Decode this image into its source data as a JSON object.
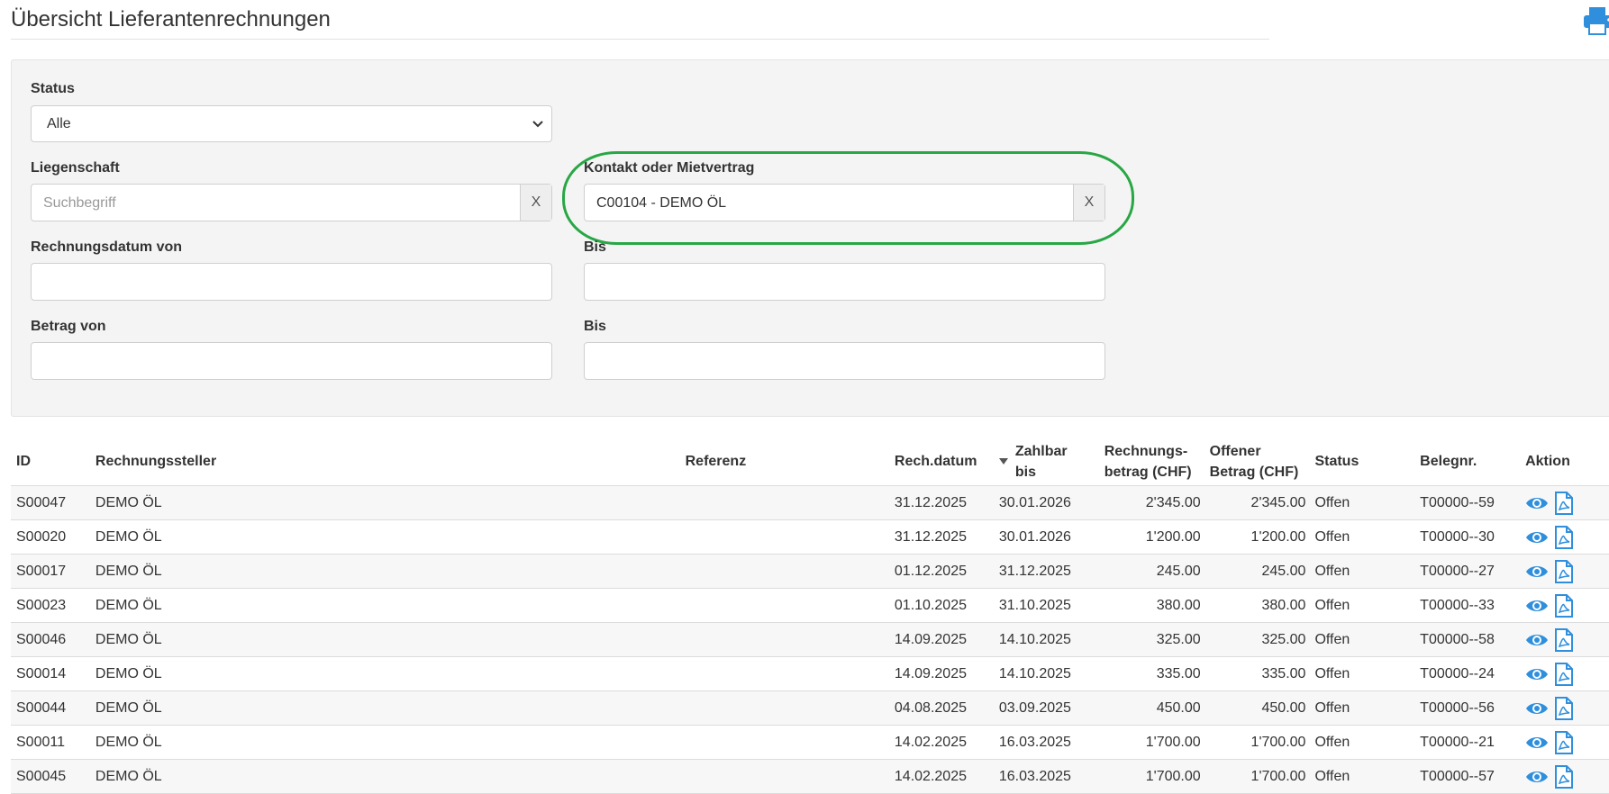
{
  "page": {
    "title": "Übersicht Lieferantenrechnungen"
  },
  "filters": {
    "status_label": "Status",
    "status_value": "Alle",
    "liegenschaft_label": "Liegenschaft",
    "liegenschaft_placeholder": "Suchbegriff",
    "clear_label": "X",
    "kontakt_label": "Kontakt oder Mietvertrag",
    "kontakt_value": "C00104 - DEMO ÖL",
    "rechdatum_von_label": "Rechnungsdatum von",
    "rechdatum_bis_label": "Bis",
    "betrag_von_label": "Betrag von",
    "betrag_bis_label": "Bis"
  },
  "table": {
    "headers": {
      "id": "ID",
      "rechnungssteller": "Rechnungssteller",
      "referenz": "Referenz",
      "rechdatum": "Rech.datum",
      "zahlbar1": "Zahlbar",
      "zahlbar2": "bis",
      "betrag1": "Rechnungs-",
      "betrag2": "betrag (CHF)",
      "offen1": "Offener",
      "offen2": "Betrag (CHF)",
      "status": "Status",
      "belegnr": "Belegnr.",
      "aktion": "Aktion"
    },
    "rows": [
      {
        "id": "S00047",
        "steller": "DEMO ÖL",
        "ref": "",
        "datum": "31.12.2025",
        "zahlbar": "30.01.2026",
        "betrag": "2'345.00",
        "offen": "2'345.00",
        "status": "Offen",
        "beleg": "T00000--59"
      },
      {
        "id": "S00020",
        "steller": "DEMO ÖL",
        "ref": "",
        "datum": "31.12.2025",
        "zahlbar": "30.01.2026",
        "betrag": "1'200.00",
        "offen": "1'200.00",
        "status": "Offen",
        "beleg": "T00000--30"
      },
      {
        "id": "S00017",
        "steller": "DEMO ÖL",
        "ref": "",
        "datum": "01.12.2025",
        "zahlbar": "31.12.2025",
        "betrag": "245.00",
        "offen": "245.00",
        "status": "Offen",
        "beleg": "T00000--27"
      },
      {
        "id": "S00023",
        "steller": "DEMO ÖL",
        "ref": "",
        "datum": "01.10.2025",
        "zahlbar": "31.10.2025",
        "betrag": "380.00",
        "offen": "380.00",
        "status": "Offen",
        "beleg": "T00000--33"
      },
      {
        "id": "S00046",
        "steller": "DEMO ÖL",
        "ref": "",
        "datum": "14.09.2025",
        "zahlbar": "14.10.2025",
        "betrag": "325.00",
        "offen": "325.00",
        "status": "Offen",
        "beleg": "T00000--58"
      },
      {
        "id": "S00014",
        "steller": "DEMO ÖL",
        "ref": "",
        "datum": "14.09.2025",
        "zahlbar": "14.10.2025",
        "betrag": "335.00",
        "offen": "335.00",
        "status": "Offen",
        "beleg": "T00000--24"
      },
      {
        "id": "S00044",
        "steller": "DEMO ÖL",
        "ref": "",
        "datum": "04.08.2025",
        "zahlbar": "03.09.2025",
        "betrag": "450.00",
        "offen": "450.00",
        "status": "Offen",
        "beleg": "T00000--56"
      },
      {
        "id": "S00011",
        "steller": "DEMO ÖL",
        "ref": "",
        "datum": "14.02.2025",
        "zahlbar": "16.03.2025",
        "betrag": "1'700.00",
        "offen": "1'700.00",
        "status": "Offen",
        "beleg": "T00000--21"
      },
      {
        "id": "S00045",
        "steller": "DEMO ÖL",
        "ref": "",
        "datum": "14.02.2025",
        "zahlbar": "16.03.2025",
        "betrag": "1'700.00",
        "offen": "1'700.00",
        "status": "Offen",
        "beleg": "T00000--57"
      }
    ]
  },
  "colors": {
    "accent": "#2f8fdc",
    "highlight": "#28a745"
  },
  "icons": {
    "print": "print-icon",
    "view": "eye-icon",
    "pdf": "pdf-icon",
    "dropdown": "chevron-down-icon",
    "sort": "sort-desc-icon"
  }
}
